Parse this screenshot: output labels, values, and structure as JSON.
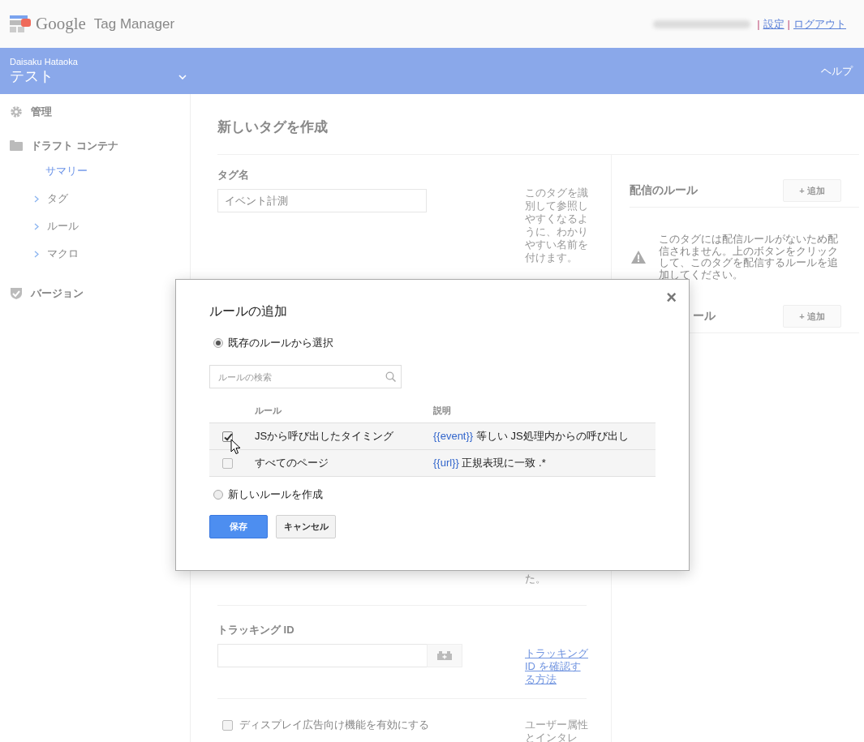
{
  "header": {
    "product": "Google",
    "product_suffix": "Tag Manager",
    "links": [
      {
        "separator": "|",
        "label": "設定"
      },
      {
        "separator": "|",
        "label": "ログアウト"
      }
    ]
  },
  "account_bar": {
    "account": "Daisaku Hataoka",
    "container": "テスト",
    "help": "ヘルプ"
  },
  "sidebar": {
    "items": [
      {
        "label": "管理"
      },
      {
        "label": "ドラフト コンテナ",
        "children": [
          {
            "label": "サマリー",
            "kind": "page",
            "selected": true
          },
          {
            "label": "タグ",
            "kind": "folder",
            "selected": false
          },
          {
            "label": "ルール",
            "kind": "folder",
            "selected": false
          },
          {
            "label": "マクロ",
            "kind": "folder",
            "selected": false
          }
        ]
      },
      {
        "label": "バージョン"
      }
    ]
  },
  "page": {
    "title": "新しいタグを作成",
    "tag_name": {
      "label": "タグ名",
      "value": "イベント計測",
      "hint": "このタグを識別して参照しやすくなるように、わかりやすい名前を付けます。",
      "hint_tail": "た。"
    },
    "tracking": {
      "label": "トラッキング ID",
      "link": "トラッキング ID を確認する方法"
    },
    "display_features": {
      "label": "ディスプレイ広告向け機能を有効にする",
      "checked": false,
      "hint": "ユーザー属性とインタレ"
    },
    "firing_rules": {
      "title": "配信のルール",
      "add": "+ 追加",
      "warning": "このタグには配信ルールがないため配信されません。上のボタンをクリックして、このタグを配信するルールを追加してください。"
    },
    "blocking_rules": {
      "title": "ール",
      "add": "+ 追加"
    }
  },
  "dialog": {
    "title": "ルールの追加",
    "close": "×",
    "options": [
      {
        "label": "既存のルールから選択",
        "selected": true
      },
      {
        "label": "新しいルールを作成",
        "selected": false
      }
    ],
    "search": {
      "placeholder": "ルールの検索"
    },
    "table": {
      "columns": [
        "ルール",
        "説明"
      ],
      "rows": [
        {
          "checked": true,
          "rule": "JSから呼び出したタイミング",
          "variable": "{{event}}",
          "condition": "等しい JS処理内からの呼び出し"
        },
        {
          "checked": false,
          "rule": "すべてのページ",
          "variable": "{{url}}",
          "condition": "正規表現に一致 .*"
        }
      ]
    },
    "buttons": [
      {
        "label": "保存",
        "kind": "primary"
      },
      {
        "label": "キャンセル",
        "kind": "secondary"
      }
    ]
  }
}
